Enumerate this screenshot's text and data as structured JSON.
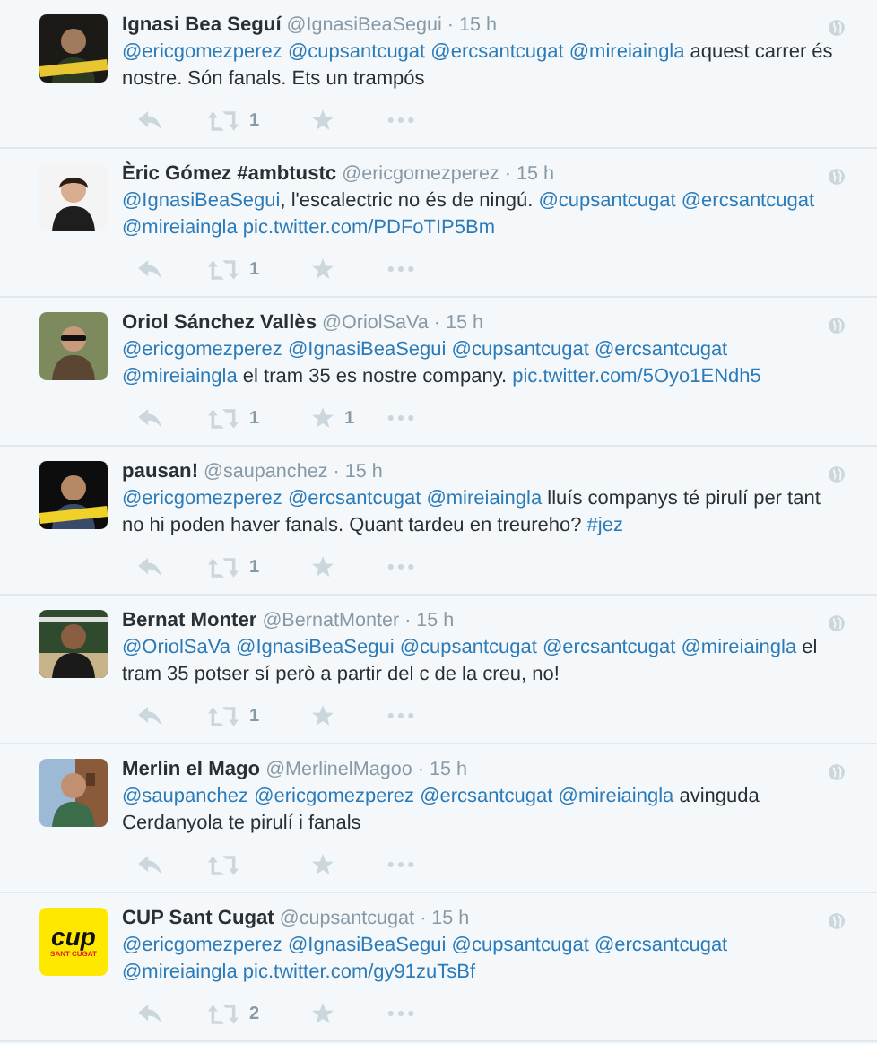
{
  "tweets": [
    {
      "avatar": {
        "kind": "picture"
      },
      "name": "Ignasi Bea Seguí",
      "handle": "@IgnasiBeaSegui",
      "time": "· 15 h",
      "text": [
        {
          "kind": "mention",
          "text": "@ericgomezperez"
        },
        {
          "kind": "mention",
          "text": "@cupsantcugat"
        },
        {
          "kind": "mention",
          "text": "@ercsantcugat"
        },
        {
          "kind": "mention",
          "text": "@mireiaingla"
        },
        {
          "kind": "plain",
          "text": " aquest carrer és nostre. Són fanals. Ets un trampós"
        }
      ],
      "retweets": "1"
    },
    {
      "avatar": {
        "kind": "picture"
      },
      "name": "Èric Gómez #ambtustc",
      "handle": "@ericgomezperez",
      "time": "· 15 h",
      "text": [
        {
          "kind": "mention",
          "text": "@IgnasiBeaSegui"
        },
        {
          "kind": "plain",
          "text": ", l'escalectric no és de ningú. "
        },
        {
          "kind": "mention",
          "text": "@cupsantcugat"
        },
        {
          "kind": "mention",
          "text": "@ercsantcugat"
        },
        {
          "kind": "mention",
          "text": "@mireiaingla"
        },
        {
          "kind": "link",
          "text": "pic.twitter.com/PDFoTIP5Bm"
        }
      ],
      "retweets": "1"
    },
    {
      "avatar": {
        "kind": "picture"
      },
      "name": "Oriol Sánchez Vallès",
      "handle": "@OriolSaVa",
      "time": "· 15 h",
      "text": [
        {
          "kind": "mention",
          "text": "@ericgomezperez"
        },
        {
          "kind": "mention",
          "text": "@IgnasiBeaSegui"
        },
        {
          "kind": "mention",
          "text": "@cupsantcugat"
        },
        {
          "kind": "mention",
          "text": "@ercsantcugat"
        },
        {
          "kind": "mention",
          "text": "@mireiaingla"
        },
        {
          "kind": "plain",
          "text": " el tram 35 es nostre company. "
        },
        {
          "kind": "link",
          "text": "pic.twitter.com/5Oyo1ENdh5"
        }
      ],
      "retweets": "1",
      "favorites": "1"
    },
    {
      "avatar": {
        "kind": "picture"
      },
      "name": "pausan!",
      "handle": "@saupanchez",
      "time": "· 15 h",
      "text": [
        {
          "kind": "mention",
          "text": "@ericgomezperez"
        },
        {
          "kind": "mention",
          "text": "@ercsantcugat"
        },
        {
          "kind": "mention",
          "text": "@mireiaingla"
        },
        {
          "kind": "plain",
          "text": " lluís companys té pirulí per tant no hi poden haver fanals. Quant tardeu en treureho? "
        },
        {
          "kind": "hashtag",
          "text": "#jez"
        }
      ],
      "retweets": "1"
    },
    {
      "avatar": {
        "kind": "picture"
      },
      "name": "Bernat Monter",
      "handle": "@BernatMonter",
      "time": "· 15 h",
      "text": [
        {
          "kind": "mention",
          "text": "@OriolSaVa"
        },
        {
          "kind": "mention",
          "text": "@IgnasiBeaSegui"
        },
        {
          "kind": "mention",
          "text": "@cupsantcugat"
        },
        {
          "kind": "mention",
          "text": "@ercsantcugat"
        },
        {
          "kind": "mention",
          "text": "@mireiaingla"
        },
        {
          "kind": "plain",
          "text": " el tram 35 potser sí però a partir del c de la creu, no!"
        }
      ],
      "retweets": "1"
    },
    {
      "avatar": {
        "kind": "picture"
      },
      "name": "Merlin el Mago",
      "handle": "@MerlinelMagoo",
      "time": "· 15 h",
      "text": [
        {
          "kind": "mention",
          "text": "@saupanchez"
        },
        {
          "kind": "mention",
          "text": "@ericgomezperez"
        },
        {
          "kind": "mention",
          "text": "@ercsantcugat"
        },
        {
          "kind": "mention",
          "text": "@mireiaingla"
        },
        {
          "kind": "plain",
          "text": " avinguda Cerdanyola te pirulí i fanals"
        }
      ]
    },
    {
      "avatar": {
        "kind": "logo",
        "mark": "cup",
        "caption": "SANT CUGAT"
      },
      "name": "CUP Sant Cugat",
      "handle": "@cupsantcugat",
      "time": "· 15 h",
      "text": [
        {
          "kind": "mention",
          "text": "@ericgomezperez"
        },
        {
          "kind": "mention",
          "text": "@IgnasiBeaSegui"
        },
        {
          "kind": "mention",
          "text": "@cupsantcugat"
        },
        {
          "kind": "mention",
          "text": "@ercsantcugat"
        },
        {
          "kind": "mention",
          "text": "@mireiaingla"
        },
        {
          "kind": "link",
          "text": "pic.twitter.com/gy91zuTsBf"
        }
      ],
      "retweets": "2"
    }
  ]
}
